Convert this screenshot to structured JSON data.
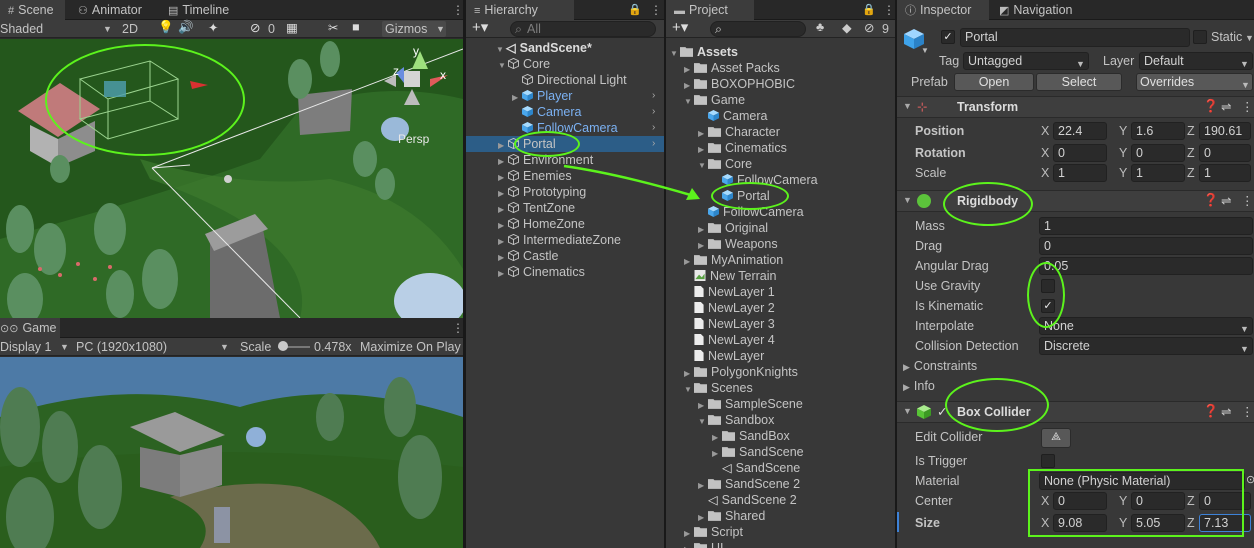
{
  "scene": {
    "tabs": [
      "Scene",
      "Animator",
      "Timeline"
    ],
    "shading": "Shaded",
    "mode_2d": "2D",
    "hidden_count": "0",
    "gizmos": "Gizmos",
    "persp": "Persp",
    "axis_y": "y",
    "axis_x": "x",
    "axis_z": "z"
  },
  "game": {
    "tab": "Game",
    "display": "Display 1",
    "resolution": "PC (1920x1080)",
    "scale_label": "Scale",
    "scale_value": "0.478x",
    "maximize": "Maximize On Play"
  },
  "hierarchy": {
    "tab": "Hierarchy",
    "search_placeholder": "All",
    "scene_name": "SandScene*",
    "items": [
      {
        "label": "Core",
        "depth": 1,
        "expanded": true,
        "prefab": false
      },
      {
        "label": "Directional Light",
        "depth": 2,
        "prefab": false
      },
      {
        "label": "Player",
        "depth": 2,
        "prefab": true,
        "arrow": true
      },
      {
        "label": "Camera",
        "depth": 2,
        "prefab": true
      },
      {
        "label": "FollowCamera",
        "depth": 2,
        "prefab": true
      },
      {
        "label": "Portal",
        "depth": 1,
        "prefab": false,
        "selected": true
      },
      {
        "label": "Environment",
        "depth": 1,
        "prefab": false
      },
      {
        "label": "Enemies",
        "depth": 1,
        "prefab": false
      },
      {
        "label": "Prototyping",
        "depth": 1,
        "prefab": false
      },
      {
        "label": "TentZone",
        "depth": 1,
        "prefab": false
      },
      {
        "label": "HomeZone",
        "depth": 1,
        "prefab": false
      },
      {
        "label": "IntermediateZone",
        "depth": 1,
        "prefab": false
      },
      {
        "label": "Castle",
        "depth": 1,
        "prefab": false
      },
      {
        "label": "Cinematics",
        "depth": 1,
        "prefab": false
      }
    ]
  },
  "project": {
    "tab": "Project",
    "hidden_count": "9",
    "root": "Assets",
    "items": [
      {
        "label": "Asset Packs",
        "depth": 1,
        "type": "folder"
      },
      {
        "label": "BOXOPHOBIC",
        "depth": 1,
        "type": "folder"
      },
      {
        "label": "Game",
        "depth": 1,
        "type": "folder",
        "expanded": true
      },
      {
        "label": "Camera",
        "depth": 2,
        "type": "prefab"
      },
      {
        "label": "Character",
        "depth": 2,
        "type": "folder"
      },
      {
        "label": "Cinematics",
        "depth": 2,
        "type": "folder"
      },
      {
        "label": "Core",
        "depth": 2,
        "type": "folder",
        "expanded": true
      },
      {
        "label": "FollowCamera",
        "depth": 3,
        "type": "prefab"
      },
      {
        "label": "Portal",
        "depth": 3,
        "type": "prefab"
      },
      {
        "label": "FollowCamera",
        "depth": 2,
        "type": "prefab"
      },
      {
        "label": "Original",
        "depth": 2,
        "type": "folder"
      },
      {
        "label": "Weapons",
        "depth": 2,
        "type": "folder"
      },
      {
        "label": "MyAnimation",
        "depth": 1,
        "type": "folder"
      },
      {
        "label": "New Terrain",
        "depth": 1,
        "type": "terrain"
      },
      {
        "label": "NewLayer 1",
        "depth": 1,
        "type": "file"
      },
      {
        "label": "NewLayer 2",
        "depth": 1,
        "type": "file"
      },
      {
        "label": "NewLayer 3",
        "depth": 1,
        "type": "file"
      },
      {
        "label": "NewLayer 4",
        "depth": 1,
        "type": "file"
      },
      {
        "label": "NewLayer",
        "depth": 1,
        "type": "file"
      },
      {
        "label": "PolygonKnights",
        "depth": 1,
        "type": "folder"
      },
      {
        "label": "Scenes",
        "depth": 1,
        "type": "folder",
        "expanded": true
      },
      {
        "label": "SampleScene",
        "depth": 2,
        "type": "folder"
      },
      {
        "label": "Sandbox",
        "depth": 2,
        "type": "folder",
        "expanded": true
      },
      {
        "label": "SandBox",
        "depth": 3,
        "type": "folder"
      },
      {
        "label": "SandScene",
        "depth": 3,
        "type": "folder"
      },
      {
        "label": "SandScene",
        "depth": 3,
        "type": "scene"
      },
      {
        "label": "SandScene 2",
        "depth": 2,
        "type": "folder"
      },
      {
        "label": "SandScene 2",
        "depth": 2,
        "type": "scene"
      },
      {
        "label": "Shared",
        "depth": 2,
        "type": "folder"
      },
      {
        "label": "Script",
        "depth": 1,
        "type": "folder"
      },
      {
        "label": "UI",
        "depth": 1,
        "type": "folder"
      }
    ]
  },
  "inspector": {
    "tabs": [
      "Inspector",
      "Navigation"
    ],
    "object_name": "Portal",
    "static_label": "Static",
    "tag_label": "Tag",
    "tag_value": "Untagged",
    "layer_label": "Layer",
    "layer_value": "Default",
    "prefab_label": "Prefab",
    "open_label": "Open",
    "select_label": "Select",
    "overrides_label": "Overrides",
    "transform": {
      "title": "Transform",
      "position_label": "Position",
      "rotation_label": "Rotation",
      "scale_label": "Scale",
      "position": [
        "22.4",
        "1.6",
        "190.61"
      ],
      "rotation": [
        "0",
        "0",
        "0"
      ],
      "scale": [
        "1",
        "1",
        "1"
      ]
    },
    "rigidbody": {
      "title": "Rigidbody",
      "mass_label": "Mass",
      "mass": "1",
      "drag_label": "Drag",
      "drag": "0",
      "angular_drag_label": "Angular Drag",
      "angular_drag": "0.05",
      "use_gravity_label": "Use Gravity",
      "use_gravity": false,
      "is_kinematic_label": "Is Kinematic",
      "is_kinematic": true,
      "interpolate_label": "Interpolate",
      "interpolate": "None",
      "collision_label": "Collision Detection",
      "collision": "Discrete",
      "constraints_label": "Constraints",
      "info_label": "Info"
    },
    "box_collider": {
      "title": "Box Collider",
      "edit_label": "Edit Collider",
      "is_trigger_label": "Is Trigger",
      "material_label": "Material",
      "material": "None (Physic Material)",
      "center_label": "Center",
      "center": [
        "0",
        "0",
        "0"
      ],
      "size_label": "Size",
      "size": [
        "9.08",
        "5.05",
        "7.13"
      ]
    }
  },
  "colors": {
    "annotation": "#5cf31c",
    "prefab_blue": "#7bb1f2",
    "panel_bg": "#383838",
    "tab_bg": "#282828"
  }
}
